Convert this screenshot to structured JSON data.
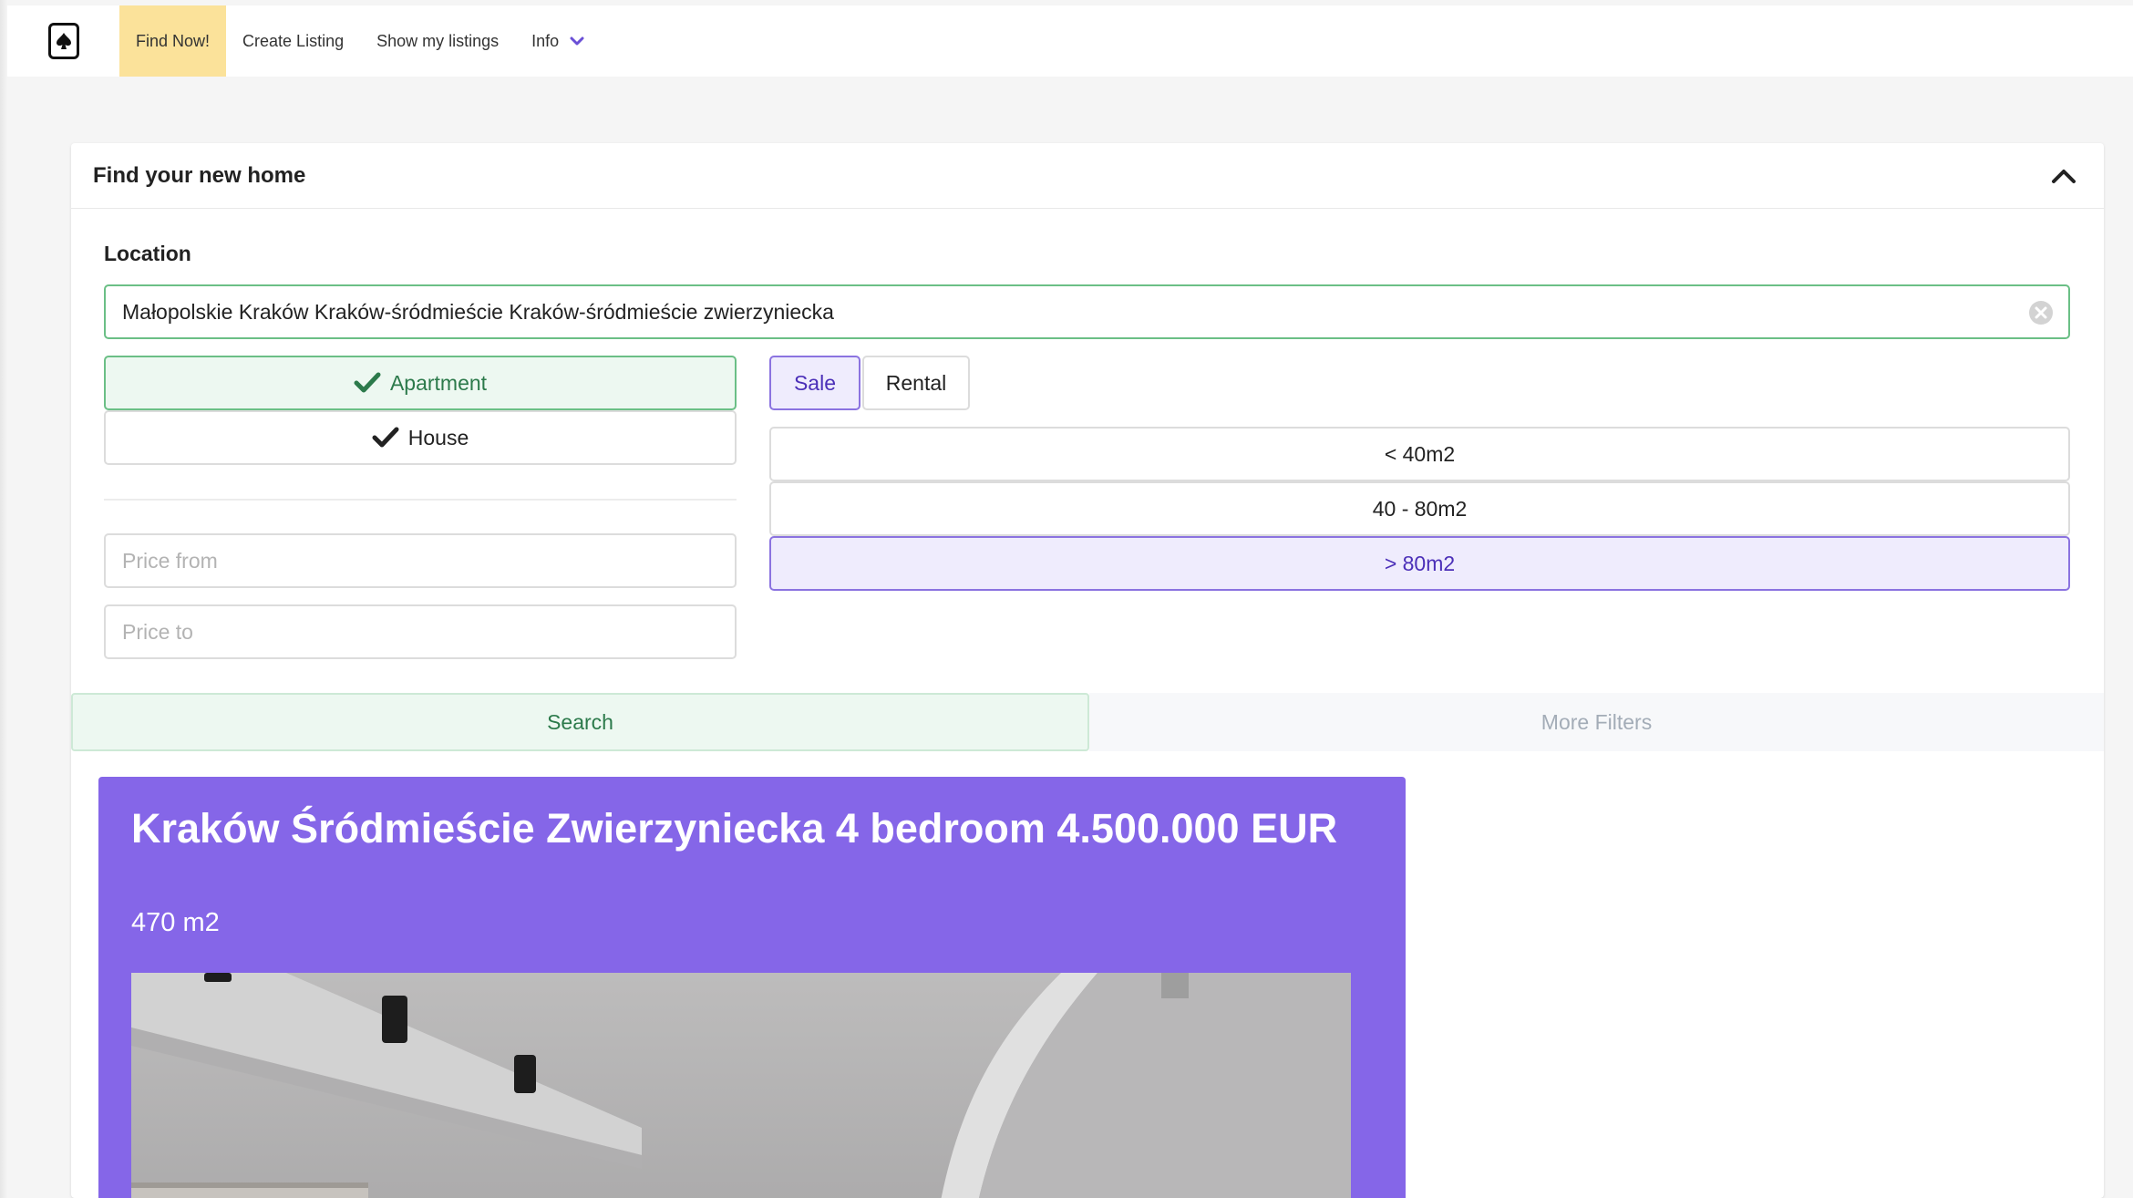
{
  "nav": {
    "brand_icon": "spade-card-icon",
    "items": [
      {
        "label": "Find Now!"
      },
      {
        "label": "Create Listing"
      },
      {
        "label": "Show my listings"
      },
      {
        "label": "Info"
      }
    ]
  },
  "search": {
    "title": "Find your new home",
    "location_label": "Location",
    "location_value": "Małopolskie Kraków Kraków-śródmieście Kraków-śródmieście zwierzyniecka",
    "property_types": [
      {
        "label": "Apartment",
        "selected": true
      },
      {
        "label": "House",
        "selected": false
      }
    ],
    "deal_types": [
      {
        "label": "Sale",
        "selected": true
      },
      {
        "label": "Rental",
        "selected": false
      }
    ],
    "sizes": [
      {
        "label": "< 40m2",
        "selected": false
      },
      {
        "label": "40 - 80m2",
        "selected": false
      },
      {
        "label": "> 80m2",
        "selected": true
      }
    ],
    "price_from_placeholder": "Price from",
    "price_to_placeholder": "Price to",
    "search_label": "Search",
    "more_filters_label": "More Filters"
  },
  "listing": {
    "title": "Kraków Śródmieście Zwierzyniecka 4 bedroom 4.500.000 EUR",
    "area": "470 m2"
  },
  "colors": {
    "nav_active": "#fbe29a",
    "accent_green": "#6bbf86",
    "accent_purple": "#8566e8"
  }
}
